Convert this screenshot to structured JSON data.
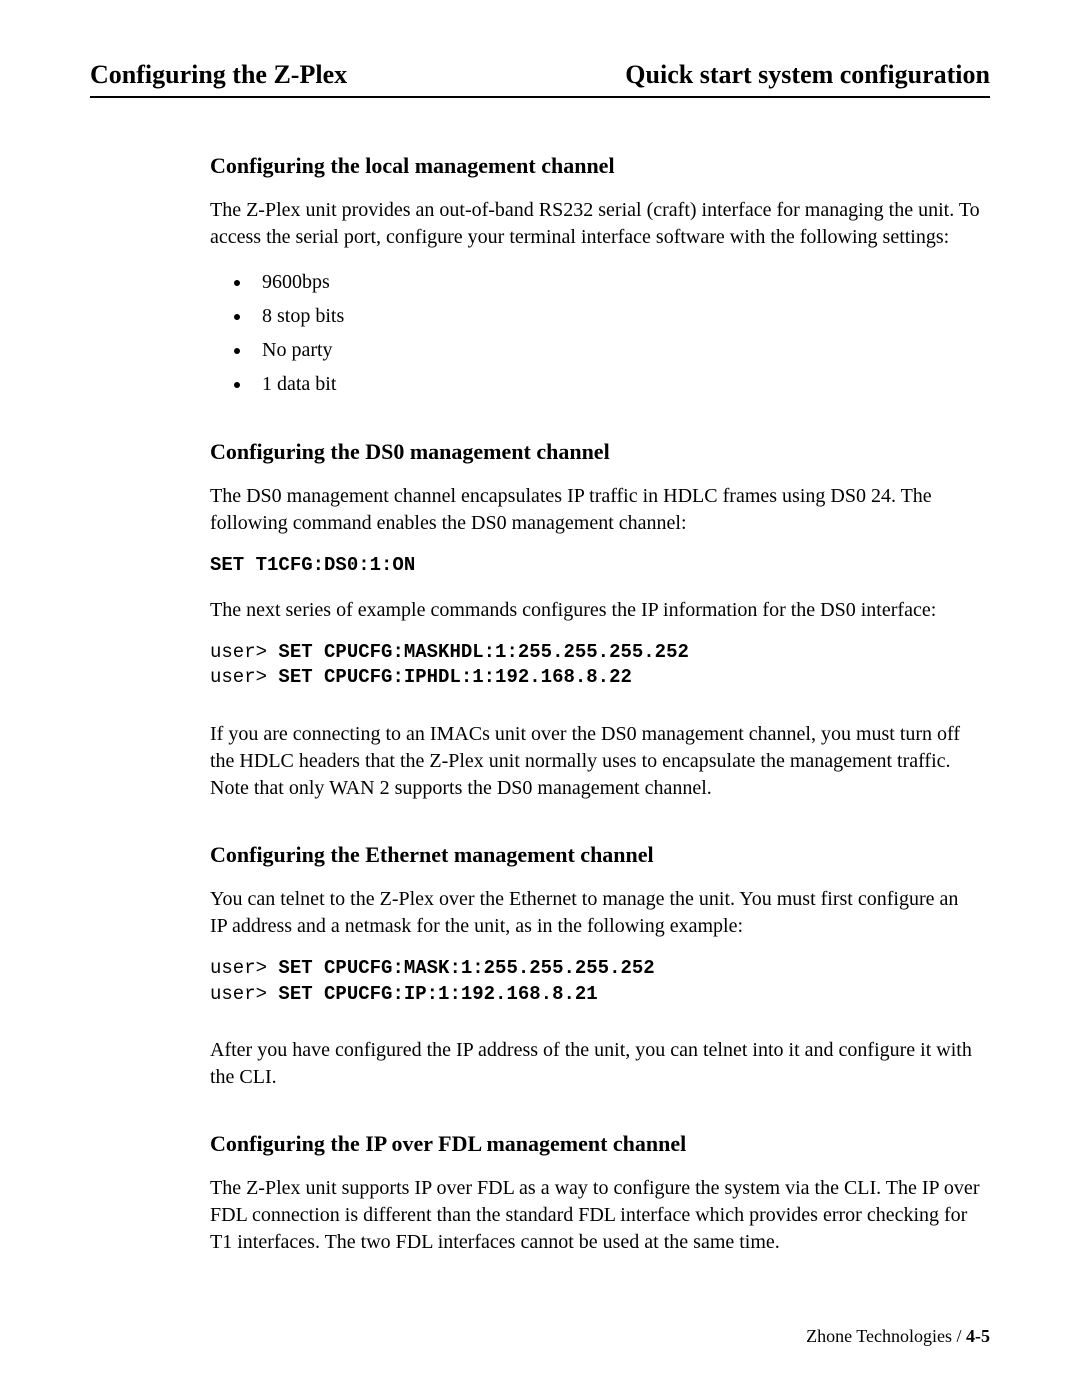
{
  "header": {
    "left": "Configuring the Z-Plex",
    "right": "Quick start system configuration"
  },
  "sections": {
    "local": {
      "heading": "Configuring the local management channel",
      "intro": "The Z-Plex unit provides an out-of-band RS232 serial (craft) interface for managing the unit. To access the serial port, configure your terminal interface software with the following settings:",
      "bullets": [
        "9600bps",
        "8 stop bits",
        "No party",
        "1 data bit"
      ]
    },
    "ds0": {
      "heading": "Configuring the DS0 management channel",
      "p1": "The DS0 management channel encapsulates IP traffic in HDLC frames using DS0 24. The following command enables the DS0 management channel:",
      "cmd1": "SET T1CFG:DS0:1:ON",
      "p2": "The next series of example commands configures the IP information for the DS0 interface:",
      "cmds": {
        "prompt": "user>",
        "line1": "SET CPUCFG:MASKHDL:1:255.255.255.252",
        "line2": "SET CPUCFG:IPHDL:1:192.168.8.22"
      },
      "p3": "If you are connecting to an IMACs unit over the DS0 management channel, you must turn off the HDLC headers that the Z-Plex unit normally uses to encapsulate the management traffic. Note that only WAN 2 supports the DS0 management channel."
    },
    "eth": {
      "heading": "Configuring the Ethernet management channel",
      "p1": "You can telnet to the Z-Plex over the Ethernet to manage the unit. You must first configure an IP address and a netmask for the unit, as in the following example:",
      "cmds": {
        "prompt": "user>",
        "line1": "SET CPUCFG:MASK:1:255.255.255.252",
        "line2": "SET CPUCFG:IP:1:192.168.8.21"
      },
      "p2": "After you have configured the IP address of the unit, you can telnet into it and configure it with the CLI."
    },
    "fdl": {
      "heading": "Configuring the IP over FDL management channel",
      "p1": "The Z-Plex unit supports IP over FDL as a way to configure the system via the CLI. The IP over FDL connection is different than the standard FDL interface which provides error checking for T1 interfaces. The two FDL interfaces cannot be used at the same time."
    }
  },
  "footer": {
    "company": "Zhone Technologies /",
    "page": "4-5"
  }
}
